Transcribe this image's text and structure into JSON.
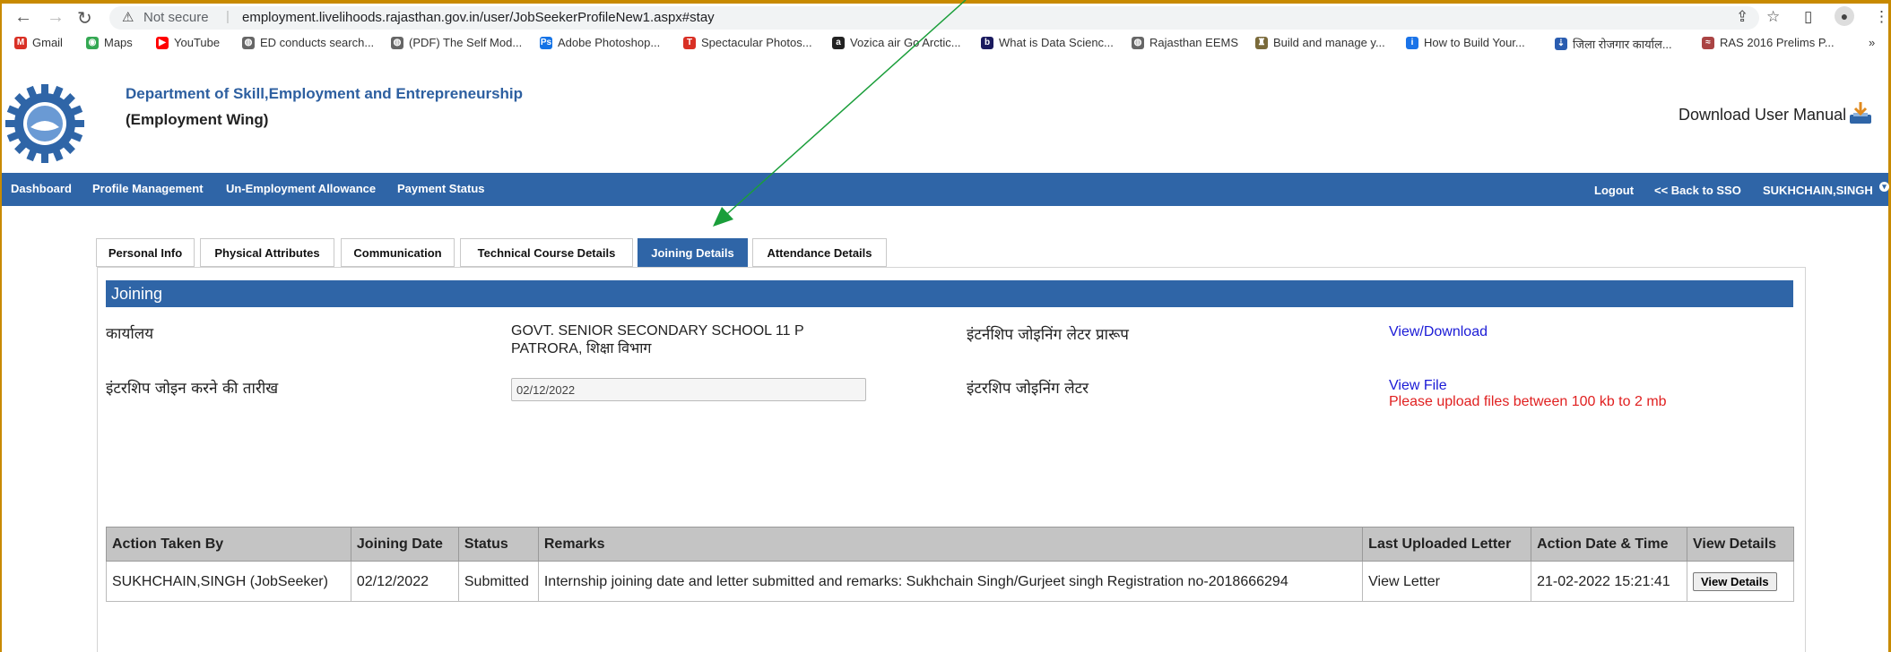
{
  "browser": {
    "not_secure": "Not secure",
    "url": "employment.livelihoods.rajasthan.gov.in/user/JobSeekerProfileNew1.aspx#stay",
    "bookmarks": [
      {
        "label": "Gmail",
        "icon": "gmail-icon",
        "color": "#d93025"
      },
      {
        "label": "Maps",
        "icon": "maps-icon",
        "color": "#34a853"
      },
      {
        "label": "YouTube",
        "icon": "youtube-icon",
        "color": "#ff0000"
      },
      {
        "label": "ED conducts search...",
        "icon": "globe-icon",
        "color": "#666666"
      },
      {
        "label": "(PDF) The Self Mod...",
        "icon": "globe-icon",
        "color": "#666666"
      },
      {
        "label": "Adobe Photoshop...",
        "icon": "adobe-icon",
        "color": "#1473e6"
      },
      {
        "label": "Spectacular Photos...",
        "icon": "t-icon",
        "color": "#d93025"
      },
      {
        "label": "Vozica air Go Arctic...",
        "icon": "amazon-icon",
        "color": "#222222"
      },
      {
        "label": "What is Data Scienc...",
        "icon": "b-icon",
        "color": "#1a1a5e"
      },
      {
        "label": "Rajasthan EEMS",
        "icon": "globe-icon",
        "color": "#666666"
      },
      {
        "label": "Build and manage y...",
        "icon": "emblem-icon",
        "color": "#7a6a3a"
      },
      {
        "label": "How to Build Your...",
        "icon": "info-icon",
        "color": "#1a73e8"
      },
      {
        "label": "जिला रोजगार कार्याल...",
        "icon": "download-icon",
        "color": "#2a5db0"
      },
      {
        "label": "RAS 2016 Prelims P...",
        "icon": "web-icon",
        "color": "#aa4444"
      }
    ],
    "more": "»"
  },
  "header": {
    "title": "Department of Skill,Employment and Entrepreneurship",
    "subtitle": "(Employment Wing)",
    "manual": "Download User Manual"
  },
  "nav": {
    "left": [
      "Dashboard",
      "Profile Management",
      "Un-Employment Allowance",
      "Payment Status"
    ],
    "logout": "Logout",
    "back": "<< Back to SSO",
    "user": "SUKHCHAIN,SINGH"
  },
  "tabs": [
    "Personal Info",
    "Physical Attributes",
    "Communication",
    "Technical Course Details",
    "Joining Details",
    "Attendance Details"
  ],
  "active_tab": "Joining Details",
  "joining": {
    "section_title": "Joining",
    "office_label": "कार्यालय",
    "office_value_line1": "GOVT. SENIOR SECONDARY SCHOOL 11 P",
    "office_value_line2": "PATRORA, शिक्षा विभाग",
    "letter_format_label": "इंटर्नशिप जोइनिंग लेटर प्रारूप",
    "letter_format_link": "View/Download",
    "join_date_label": "इंटरशिप जोइन करने की तारीख",
    "join_date_value": "02/12/2022",
    "letter_label": "इंटरशिप जोइनिंग लेटर",
    "letter_link": "View File",
    "upload_note": "Please upload files between 100 kb to 2 mb"
  },
  "history": {
    "headers": [
      "Action Taken By",
      "Joining Date",
      "Status",
      "Remarks",
      "Last Uploaded Letter",
      "Action Date & Time",
      "View Details"
    ],
    "rows": [
      {
        "by": "SUKHCHAIN,SINGH (JobSeeker)",
        "date": "02/12/2022",
        "status": "Submitted",
        "remarks": "Internship joining date and letter submitted and remarks: Sukhchain Singh/Gurjeet singh Registration no-2018666294",
        "letter": "View Letter",
        "action_time": "21-02-2022 15:21:41",
        "button": "View Details"
      }
    ]
  }
}
